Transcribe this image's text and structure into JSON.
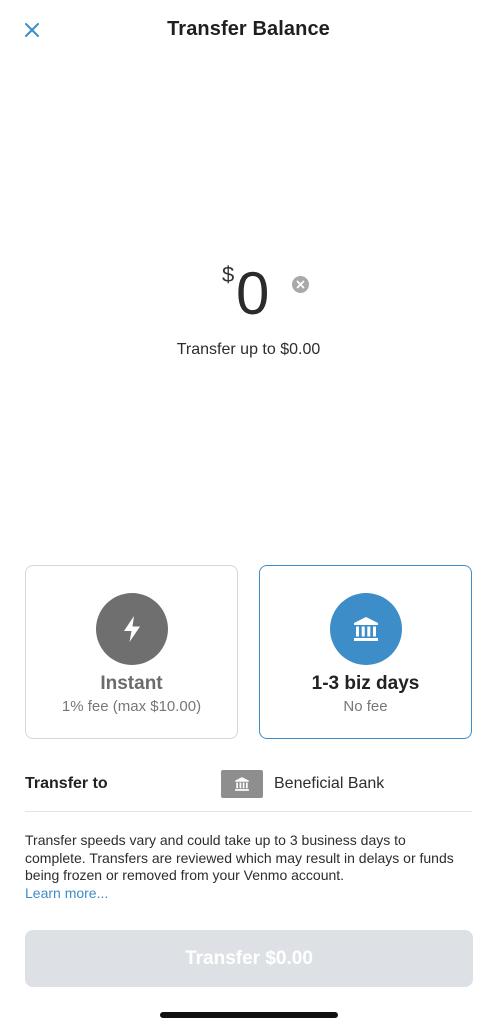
{
  "header": {
    "title": "Transfer Balance",
    "close_icon": "close-icon"
  },
  "amount": {
    "currency_symbol": "$",
    "value": "0",
    "clear_icon": "clear-circle-icon",
    "limit_text": "Transfer up to $0.00"
  },
  "speed_options": [
    {
      "title": "Instant",
      "subtitle": "1% fee (max $10.00)",
      "icon": "lightning-bolt-icon",
      "selected": false
    },
    {
      "title": "1-3 biz days",
      "subtitle": "No fee",
      "icon": "bank-icon",
      "selected": true
    }
  ],
  "transfer_to": {
    "label": "Transfer to",
    "bank_name": "Beneficial Bank",
    "icon": "bank-icon"
  },
  "disclaimer": {
    "text": "Transfer speeds vary and could take up to 3 business days to complete. Transfers are reviewed which may result in delays or funds being frozen or removed from your Venmo account.",
    "link_text": "Learn more..."
  },
  "cta": {
    "label": "Transfer $0.00",
    "enabled": false
  },
  "colors": {
    "accent": "#3d8dc8",
    "instant_circle": "#6f6f6f",
    "button_disabled": "#dde1e6"
  }
}
